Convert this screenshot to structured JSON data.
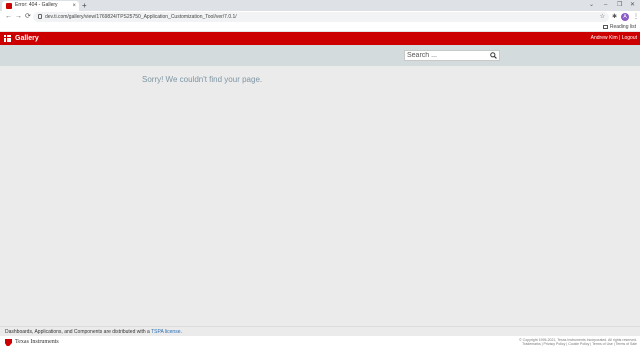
{
  "browser": {
    "tab_title": "Error: 404 - Gallery",
    "tab_close": "×",
    "new_tab": "+",
    "window_controls": [
      "⌄",
      "–",
      "❐",
      "✕"
    ],
    "nav": {
      "back": "←",
      "forward": "→",
      "reload": "⟳"
    },
    "url": "dev.ti.com/gallery/view/1769824/TPS25750_Application_Customization_Tool/ver/7.0.1/",
    "star": "☆",
    "extensions_icon": "✱",
    "bookmark_icon": "⊞",
    "profile_initial": "A",
    "menu": "⋮",
    "reading_list": "Reading list"
  },
  "app": {
    "title": "Gallery",
    "user_name": "Andrew Kim",
    "separator": "|",
    "logout": "Logout",
    "brand_color": "#cc0000"
  },
  "search": {
    "placeholder": "Search ..."
  },
  "main": {
    "error_message": "Sorry! We couldn't find your page."
  },
  "footer": {
    "note_prefix": "Dashboards, Applications, and Components are distributed with a ",
    "license_link": "TSPA license",
    "note_suffix": ".",
    "company": "Texas Instruments",
    "copyright_line1": "© Copyright 1995-2021, Texas Instruments Incorporated. All rights reserved.",
    "copyright_line2": "Trademarks | Privacy Policy | Cookie Policy | Terms of Use | Terms of Sale"
  }
}
